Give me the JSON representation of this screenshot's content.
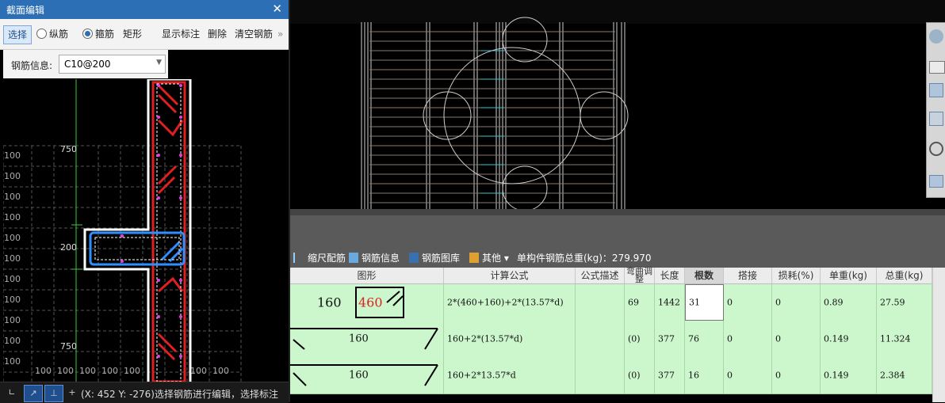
{
  "dialog": {
    "title": "截面编辑",
    "close": "✕",
    "toolbar": {
      "select": "选择",
      "longitudinal": "纵筋",
      "stirrup": "箍筋",
      "shape": "矩形",
      "show_label": "显示标注",
      "delete": "删除",
      "clear": "清空钢筋",
      "more": "»"
    },
    "rebar_info_label": "钢筋信息:",
    "rebar_info_value": "C10@200",
    "canvas_labels": {
      "dim_750_top": "750",
      "dim_200": "200",
      "dim_750_bottom": "750",
      "grid_cell": "100"
    },
    "status": "(X: 452 Y: -276)选择钢筋进行编辑，选择标注"
  },
  "bottom_toolbar": {
    "scale": "缩尺配筋",
    "info": "钢筋信息",
    "library": "钢筋图库",
    "other": "其他",
    "total_label": "单构件钢筋总重(kg)：279.970"
  },
  "table": {
    "headers": [
      "图形",
      "计算公式",
      "公式描述",
      "弯曲调整",
      "长度",
      "根数",
      "搭接",
      "损耗(%)",
      "单重(kg)",
      "总重(kg)"
    ],
    "rows": [
      {
        "shape_a": "160",
        "shape_b": "460",
        "formula": "2*(460+160)+2*(13.57*d)",
        "desc": "",
        "bend": "69",
        "length": "1442",
        "count": "31",
        "lap": "0",
        "loss": "0",
        "unit_weight": "0.89",
        "total_weight": "27.59"
      },
      {
        "shape_a": "160",
        "shape_b": "",
        "formula": "160+2*(13.57*d)",
        "desc": "",
        "bend": "(0)",
        "length": "377",
        "count": "76",
        "lap": "0",
        "loss": "0",
        "unit_weight": "0.149",
        "total_weight": "11.324"
      },
      {
        "shape_a": "160",
        "shape_b": "",
        "formula": "160+2*13.57*d",
        "desc": "",
        "bend": "(0)",
        "length": "377",
        "count": "16",
        "lap": "0",
        "loss": "0",
        "unit_weight": "0.149",
        "total_weight": "2.384"
      }
    ]
  },
  "colors": {
    "title_bar": "#2c6fb5",
    "table_row": "#ccf6cc",
    "rebar_red": "#e02020",
    "rebar_blue": "#2f8fff",
    "guide_green": "#33cc33"
  }
}
